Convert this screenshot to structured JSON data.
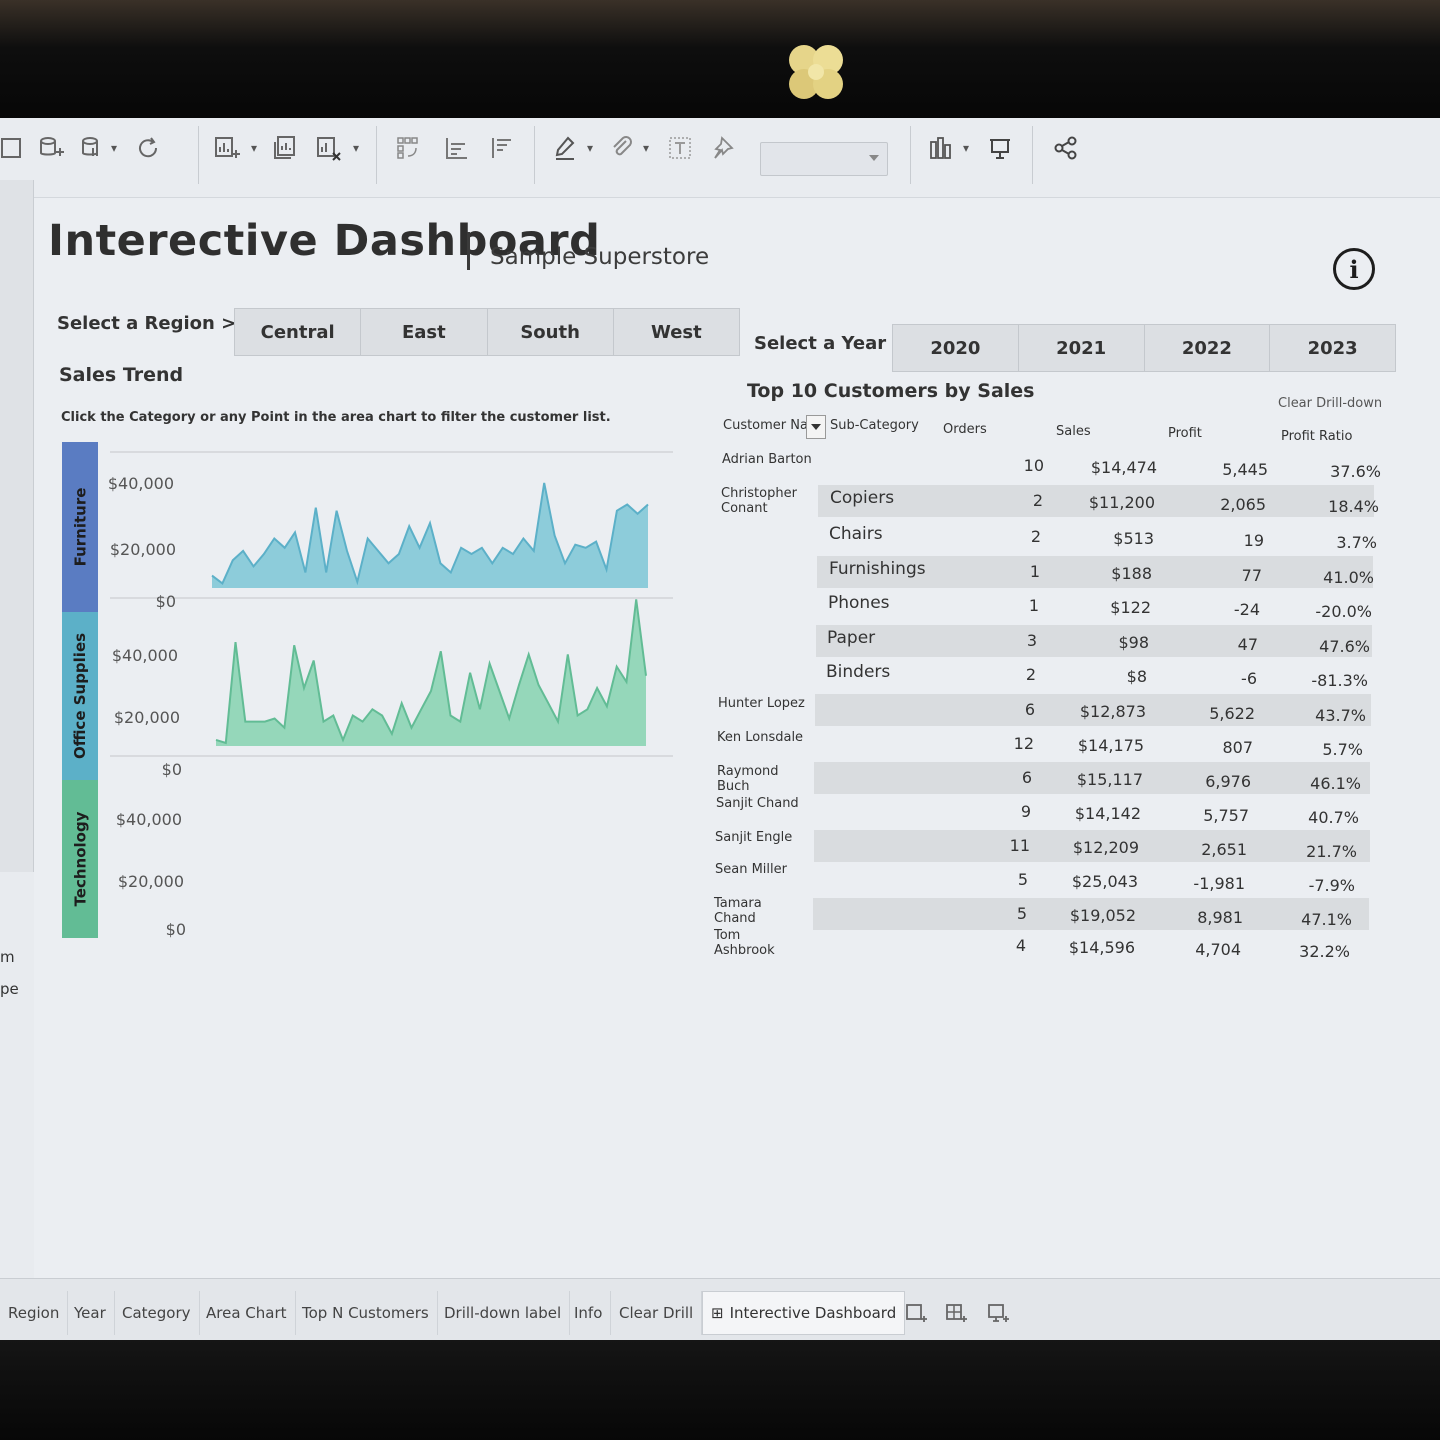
{
  "toolbar": {
    "icons": [
      "new-data-source-icon",
      "paste-data-icon",
      "refresh-icon",
      "new-worksheet-icon",
      "duplicate-icon",
      "clear-sheet-icon",
      "swap-icon",
      "sort-ascending-icon",
      "sort-descending-icon",
      "highlight-icon",
      "group-icon",
      "text-label-icon",
      "pin-icon",
      "show-me-icon",
      "presentation-icon",
      "share-icon"
    ],
    "fit_value": ""
  },
  "left_fragments": [
    "m",
    "pe"
  ],
  "header": {
    "title": "Interective Dashboard",
    "subtitle": "Sample Superstore",
    "info_symbol": "i"
  },
  "region_filter": {
    "label": "Select a Region >",
    "options": [
      "Central",
      "East",
      "South",
      "West"
    ]
  },
  "year_filter": {
    "label": "Select a Year >",
    "options": [
      "2020",
      "2021",
      "2022",
      "2023"
    ]
  },
  "sales_trend": {
    "title": "Sales Trend",
    "hint": "Click the Category or any Point in the area chart to filter the customer list."
  },
  "chart_data": {
    "type": "area",
    "y_ticks": [
      "$40,000",
      "$20,000",
      "$0"
    ],
    "ylim": [
      0,
      55000
    ],
    "panels": [
      {
        "name": "Furniture",
        "color": "#7d9fdc",
        "band_color": "#5a7cc2",
        "values": [
          5000,
          2000,
          4000,
          18000,
          9000,
          13000,
          8000,
          11000,
          4000,
          25000,
          16000,
          32000,
          13000,
          4000,
          15000,
          11000,
          13000,
          9000,
          16000,
          7000,
          28000,
          16000,
          29000,
          20000,
          9000,
          4000,
          16000,
          15000,
          17000,
          15000,
          16000,
          4000,
          26000,
          17000,
          34000,
          25000,
          4000,
          6000,
          5000,
          15000,
          16000,
          12000,
          9000,
          13000,
          27000,
          22000,
          34000,
          30000
        ]
      },
      {
        "name": "Office Supplies",
        "color": "#7cc6d6",
        "band_color": "#5cb0c8",
        "values": [
          4000,
          1500,
          9000,
          12000,
          7000,
          11000,
          16000,
          13000,
          18000,
          5000,
          26000,
          5000,
          25000,
          12000,
          2000,
          16000,
          12000,
          8000,
          11000,
          20000,
          13000,
          21000,
          8000,
          5000,
          13000,
          11000,
          13000,
          8000,
          13000,
          11000,
          16000,
          12000,
          34000,
          17000,
          8000,
          14000,
          13000,
          15000,
          6000,
          25000,
          27000,
          24000,
          27000
        ]
      },
      {
        "name": "Technology",
        "color": "#86d2b0",
        "band_color": "#62bc95",
        "values": [
          2000,
          1000,
          34000,
          8000,
          8000,
          8000,
          9000,
          6000,
          33000,
          19000,
          28000,
          8000,
          10000,
          2000,
          10000,
          8000,
          12000,
          10000,
          4000,
          14000,
          6000,
          12000,
          18000,
          31000,
          10000,
          8000,
          24000,
          12000,
          27000,
          18000,
          9000,
          20000,
          30000,
          20000,
          14000,
          8000,
          30000,
          10000,
          12000,
          19000,
          13000,
          26000,
          21000,
          48000,
          23000
        ]
      }
    ]
  },
  "top_customers": {
    "title": "Top  10 Customers by Sales",
    "clear_drill": "Clear Drill-down",
    "columns": [
      "Customer Nam",
      "Sub-Category",
      "Orders",
      "Sales",
      "Profit",
      "Profit Ratio"
    ],
    "rows": [
      {
        "customer": "Adrian Barton",
        "sub": "",
        "orders": "10",
        "sales": "$14,474",
        "profit": "5,445",
        "ratio": "37.6%"
      },
      {
        "customer": "Christopher Conant",
        "sub": "Copiers",
        "orders": "2",
        "sales": "$11,200",
        "profit": "2,065",
        "ratio": "18.4%"
      },
      {
        "customer": "",
        "sub": "Chairs",
        "orders": "2",
        "sales": "$513",
        "profit": "19",
        "ratio": "3.7%"
      },
      {
        "customer": "",
        "sub": "Furnishings",
        "orders": "1",
        "sales": "$188",
        "profit": "77",
        "ratio": "41.0%"
      },
      {
        "customer": "",
        "sub": "Phones",
        "orders": "1",
        "sales": "$122",
        "profit": "-24",
        "ratio": "-20.0%"
      },
      {
        "customer": "",
        "sub": "Paper",
        "orders": "3",
        "sales": "$98",
        "profit": "47",
        "ratio": "47.6%"
      },
      {
        "customer": "",
        "sub": "Binders",
        "orders": "2",
        "sales": "$8",
        "profit": "-6",
        "ratio": "-81.3%"
      },
      {
        "customer": "Hunter Lopez",
        "sub": "",
        "orders": "6",
        "sales": "$12,873",
        "profit": "5,622",
        "ratio": "43.7%"
      },
      {
        "customer": "Ken Lonsdale",
        "sub": "",
        "orders": "12",
        "sales": "$14,175",
        "profit": "807",
        "ratio": "5.7%"
      },
      {
        "customer": "Raymond Buch",
        "sub": "",
        "orders": "6",
        "sales": "$15,117",
        "profit": "6,976",
        "ratio": "46.1%"
      },
      {
        "customer": "Sanjit Chand",
        "sub": "",
        "orders": "9",
        "sales": "$14,142",
        "profit": "5,757",
        "ratio": "40.7%"
      },
      {
        "customer": "Sanjit Engle",
        "sub": "",
        "orders": "11",
        "sales": "$12,209",
        "profit": "2,651",
        "ratio": "21.7%"
      },
      {
        "customer": "Sean Miller",
        "sub": "",
        "orders": "5",
        "sales": "$25,043",
        "profit": "-1,981",
        "ratio": "-7.9%"
      },
      {
        "customer": "Tamara Chand",
        "sub": "",
        "orders": "5",
        "sales": "$19,052",
        "profit": "8,981",
        "ratio": "47.1%"
      },
      {
        "customer": "Tom Ashbrook",
        "sub": "",
        "orders": "4",
        "sales": "$14,596",
        "profit": "4,704",
        "ratio": "32.2%"
      }
    ]
  },
  "sheet_tabs": [
    "Region",
    "Year",
    "Category",
    "Area Chart",
    "Top N Customers",
    "Drill-down label",
    "Info",
    "Clear Drill",
    "Interective Dashboard"
  ],
  "sheet_tab_icons": [
    "new-worksheet-icon",
    "new-dashboard-icon",
    "new-story-icon"
  ]
}
